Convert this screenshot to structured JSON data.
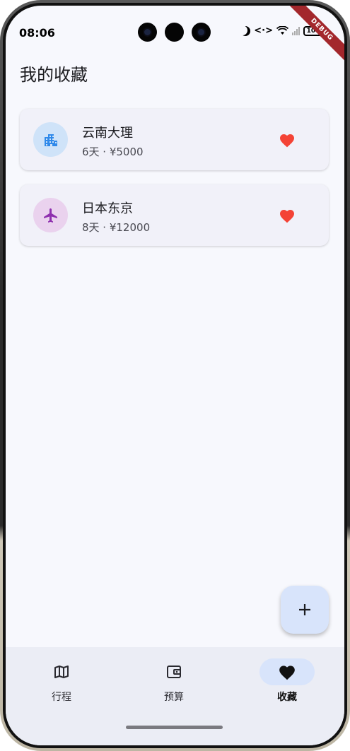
{
  "status_bar": {
    "time": "08:06",
    "battery": "100",
    "debug_banner": "DEBUG",
    "icons": [
      "moon-icon",
      "data-transfer-icon",
      "wifi-icon",
      "signal-icon",
      "battery-icon"
    ]
  },
  "page": {
    "title": "我的收藏"
  },
  "favorites": [
    {
      "title": "云南大理",
      "subtitle": "6天 · ¥5000",
      "icon": "city-icon",
      "icon_bg": "#cfe3f9",
      "icon_color": "#2f89ea",
      "heart_color": "#f44336"
    },
    {
      "title": "日本东京",
      "subtitle": "8天 · ¥12000",
      "icon": "airplane-icon",
      "icon_bg": "#ead2ee",
      "icon_color": "#8e2fae",
      "heart_color": "#f44336"
    }
  ],
  "fab": {
    "label": "+",
    "icon": "add-icon"
  },
  "bottom_nav": {
    "items": [
      {
        "label": "行程",
        "icon": "map-icon",
        "active": false
      },
      {
        "label": "预算",
        "icon": "wallet-icon",
        "active": false
      },
      {
        "label": "收藏",
        "icon": "heart-icon",
        "active": true
      }
    ]
  },
  "colors": {
    "background": "#f7f8fd",
    "card": "#f1f1f9",
    "accent": "#d8e4fb",
    "nav_bg": "#ebedf5"
  }
}
